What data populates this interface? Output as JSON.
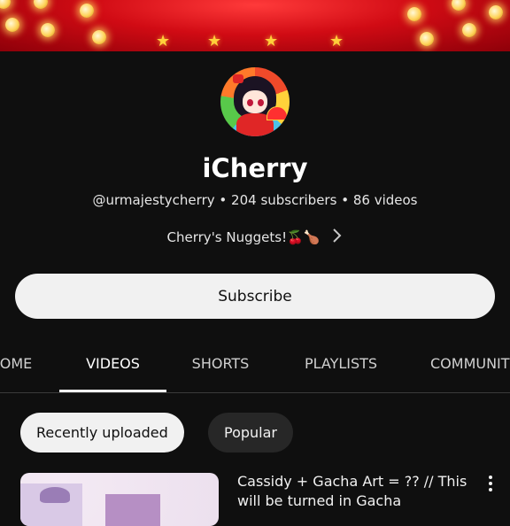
{
  "channel": {
    "name": "iCherry",
    "handle": "@urmajestycherry",
    "subscribers": "204 subscribers",
    "videos": "86 videos",
    "separator": "•",
    "description": "Cherry's Nuggets!🍒🍗"
  },
  "subscribe_label": "Subscribe",
  "tabs": [
    {
      "label": "OME"
    },
    {
      "label": "VIDEOS",
      "active": true
    },
    {
      "label": "SHORTS"
    },
    {
      "label": "PLAYLISTS"
    },
    {
      "label": "COMMUNIT"
    }
  ],
  "chips": [
    {
      "label": "Recently uploaded",
      "selected": true
    },
    {
      "label": "Popular"
    }
  ],
  "video": {
    "title": "Cassidy + Gacha Art = ?? // This will be turned in Gacha"
  },
  "icons": {
    "chevron": "chevron-right-icon",
    "more": "more-vert-icon"
  },
  "colors": {
    "background": "#0f0f0f",
    "banner_red": "#d10b14",
    "button_light": "#f1f1f1",
    "chip_dark": "#272727"
  }
}
